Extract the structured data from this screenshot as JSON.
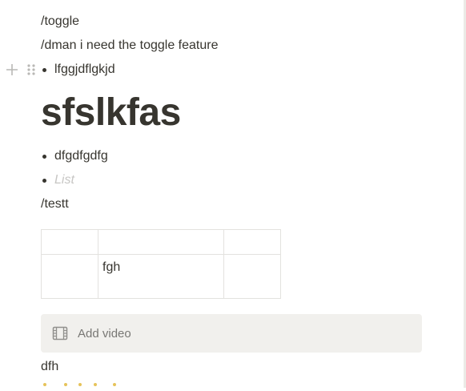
{
  "blocks": {
    "line1": "/toggle",
    "line2": "/dman i need the toggle feature",
    "bullet1": "lfggjdflgkjd",
    "heading": "sfslkfas",
    "bullet2": "dfgdfgdfg",
    "bullet3_placeholder": "List",
    "line3": "/testt",
    "line4": "dfh"
  },
  "table": {
    "rows": [
      [
        "",
        "",
        ""
      ],
      [
        "",
        "fgh",
        ""
      ]
    ]
  },
  "video": {
    "label": "Add video",
    "icon": "film-icon"
  },
  "icons": {
    "add": "plus-icon",
    "drag": "drag-handle-icon"
  },
  "colors": {
    "text": "#37352f",
    "placeholder": "#c7c6c4",
    "video_bg": "#f1f0ed",
    "star": "#e6c35a"
  },
  "rating": {
    "value": 5,
    "max": 5
  }
}
